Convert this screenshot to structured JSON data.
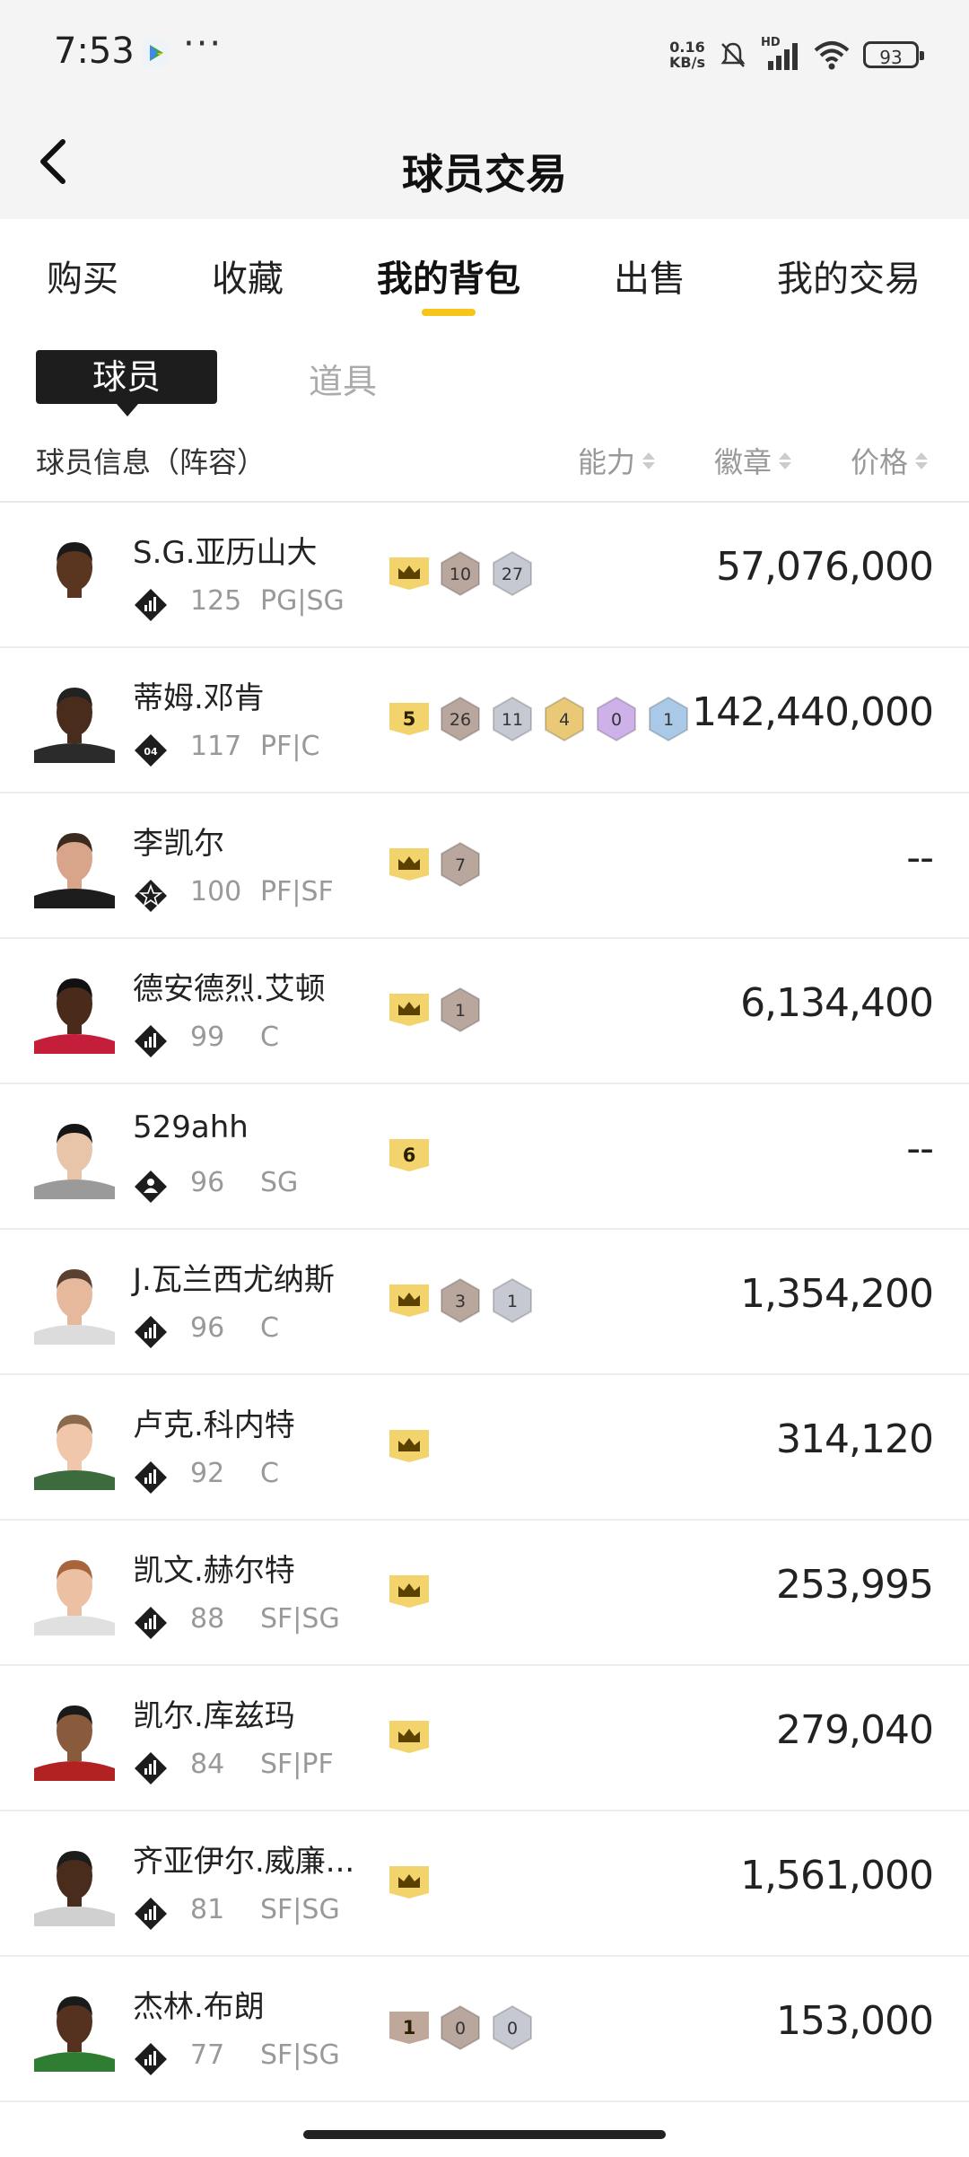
{
  "status_bar": {
    "time": "7:53",
    "speed_value": "0.16",
    "speed_unit": "KB/s",
    "hd": "HD",
    "battery": "93"
  },
  "header": {
    "title": "球员交易"
  },
  "tabs": [
    "购买",
    "收藏",
    "我的背包",
    "出售",
    "我的交易"
  ],
  "active_tab": "我的背包",
  "subtabs": {
    "active": "球员",
    "other": "道具"
  },
  "columns": {
    "info": "球员信息（阵容）",
    "ability": "能力",
    "badge": "徽章",
    "price": "价格"
  },
  "players": [
    {
      "name": "S.G.亚历山大",
      "rating": "125",
      "pos": "PG|SG",
      "tier": "bars",
      "skin": "#5a3520",
      "hair": "#1a1a1a",
      "jersey": "#ffffff",
      "badges": [
        {
          "type": "crown"
        },
        {
          "type": "hex",
          "value": "10",
          "color": "#b9a79e"
        },
        {
          "type": "hex",
          "value": "27",
          "color": "#c6c9d2"
        }
      ],
      "price": "57,076,000"
    },
    {
      "name": "蒂姆.邓肯",
      "rating": "117",
      "pos": "PF|C",
      "tier": "04",
      "skin": "#4a2c1c",
      "hair": "#222222",
      "jersey": "#2b2b2b",
      "badges": [
        {
          "type": "shield",
          "value": "5"
        },
        {
          "type": "hex",
          "value": "26",
          "color": "#b9a79e"
        },
        {
          "type": "hex",
          "value": "11",
          "color": "#c6c9d2"
        },
        {
          "type": "hex",
          "value": "4",
          "color": "#e9c877"
        },
        {
          "type": "hex",
          "value": "0",
          "color": "#cdb1e8"
        },
        {
          "type": "hex",
          "value": "1",
          "color": "#a9c9e6"
        }
      ],
      "price": "142,440,000"
    },
    {
      "name": "李凯尔",
      "rating": "100",
      "pos": "PF|SF",
      "tier": "star",
      "skin": "#d9a58a",
      "hair": "#3a2a20",
      "jersey": "#1d1d1d",
      "badges": [
        {
          "type": "crown"
        },
        {
          "type": "hex",
          "value": "7",
          "color": "#b9a79e"
        }
      ],
      "price": "--"
    },
    {
      "name": "德安德烈.艾顿",
      "rating": "99",
      "pos": "C",
      "tier": "bars",
      "skin": "#4a2a1b",
      "hair": "#111111",
      "jersey": "#c41e3a",
      "badges": [
        {
          "type": "crown"
        },
        {
          "type": "hex",
          "value": "1",
          "color": "#b9a79e"
        }
      ],
      "price": "6,134,400"
    },
    {
      "name": "529ahh",
      "rating": "96",
      "pos": "SG",
      "tier": "person",
      "skin": "#e8c5a8",
      "hair": "#151515",
      "jersey": "#9a9a9a",
      "badges": [
        {
          "type": "shield",
          "value": "6"
        }
      ],
      "price": "--"
    },
    {
      "name": "J.瓦兰西尤纳斯",
      "rating": "96",
      "pos": "C",
      "tier": "bars",
      "skin": "#e6b99c",
      "hair": "#5b4030",
      "jersey": "#dcdcdc",
      "badges": [
        {
          "type": "crown"
        },
        {
          "type": "hex",
          "value": "3",
          "color": "#b9a79e"
        },
        {
          "type": "hex",
          "value": "1",
          "color": "#c6c9d2"
        }
      ],
      "price": "1,354,200"
    },
    {
      "name": "卢克.科内特",
      "rating": "92",
      "pos": "C",
      "tier": "bars",
      "skin": "#f0c7ab",
      "hair": "#8a6a4a",
      "jersey": "#3d6b3d",
      "badges": [
        {
          "type": "crown"
        }
      ],
      "price": "314,120"
    },
    {
      "name": "凯文.赫尔特",
      "rating": "88",
      "pos": "SF|SG",
      "tier": "bars",
      "skin": "#ecc0a2",
      "hair": "#a8643c",
      "jersey": "#e0e0e0",
      "badges": [
        {
          "type": "crown"
        }
      ],
      "price": "253,995"
    },
    {
      "name": "凯尔.库兹玛",
      "rating": "84",
      "pos": "SF|PF",
      "tier": "bars",
      "skin": "#8a5a3c",
      "hair": "#1a1a1a",
      "jersey": "#b22222",
      "badges": [
        {
          "type": "crown"
        }
      ],
      "price": "279,040"
    },
    {
      "name": "齐亚伊尔.威廉...",
      "rating": "81",
      "pos": "SF|SG",
      "tier": "bars",
      "skin": "#4a2c1c",
      "hair": "#1c1c1c",
      "jersey": "#d0d0d0",
      "badges": [
        {
          "type": "crown"
        }
      ],
      "price": "1,561,000"
    },
    {
      "name": "杰林.布朗",
      "rating": "77",
      "pos": "SF|SG",
      "tier": "bars",
      "skin": "#553220",
      "hair": "#1a1a1a",
      "jersey": "#2e7d32",
      "badges": [
        {
          "type": "shield",
          "value": "1",
          "color": "#bfa79a"
        },
        {
          "type": "hex",
          "value": "0",
          "color": "#b9a79e"
        },
        {
          "type": "hex",
          "value": "0",
          "color": "#c6c9d2"
        }
      ],
      "price": "153,000"
    }
  ],
  "colors": {
    "accent": "#f5c518",
    "crown": "#f3d36b",
    "header_bg": "#f4f4f4"
  }
}
